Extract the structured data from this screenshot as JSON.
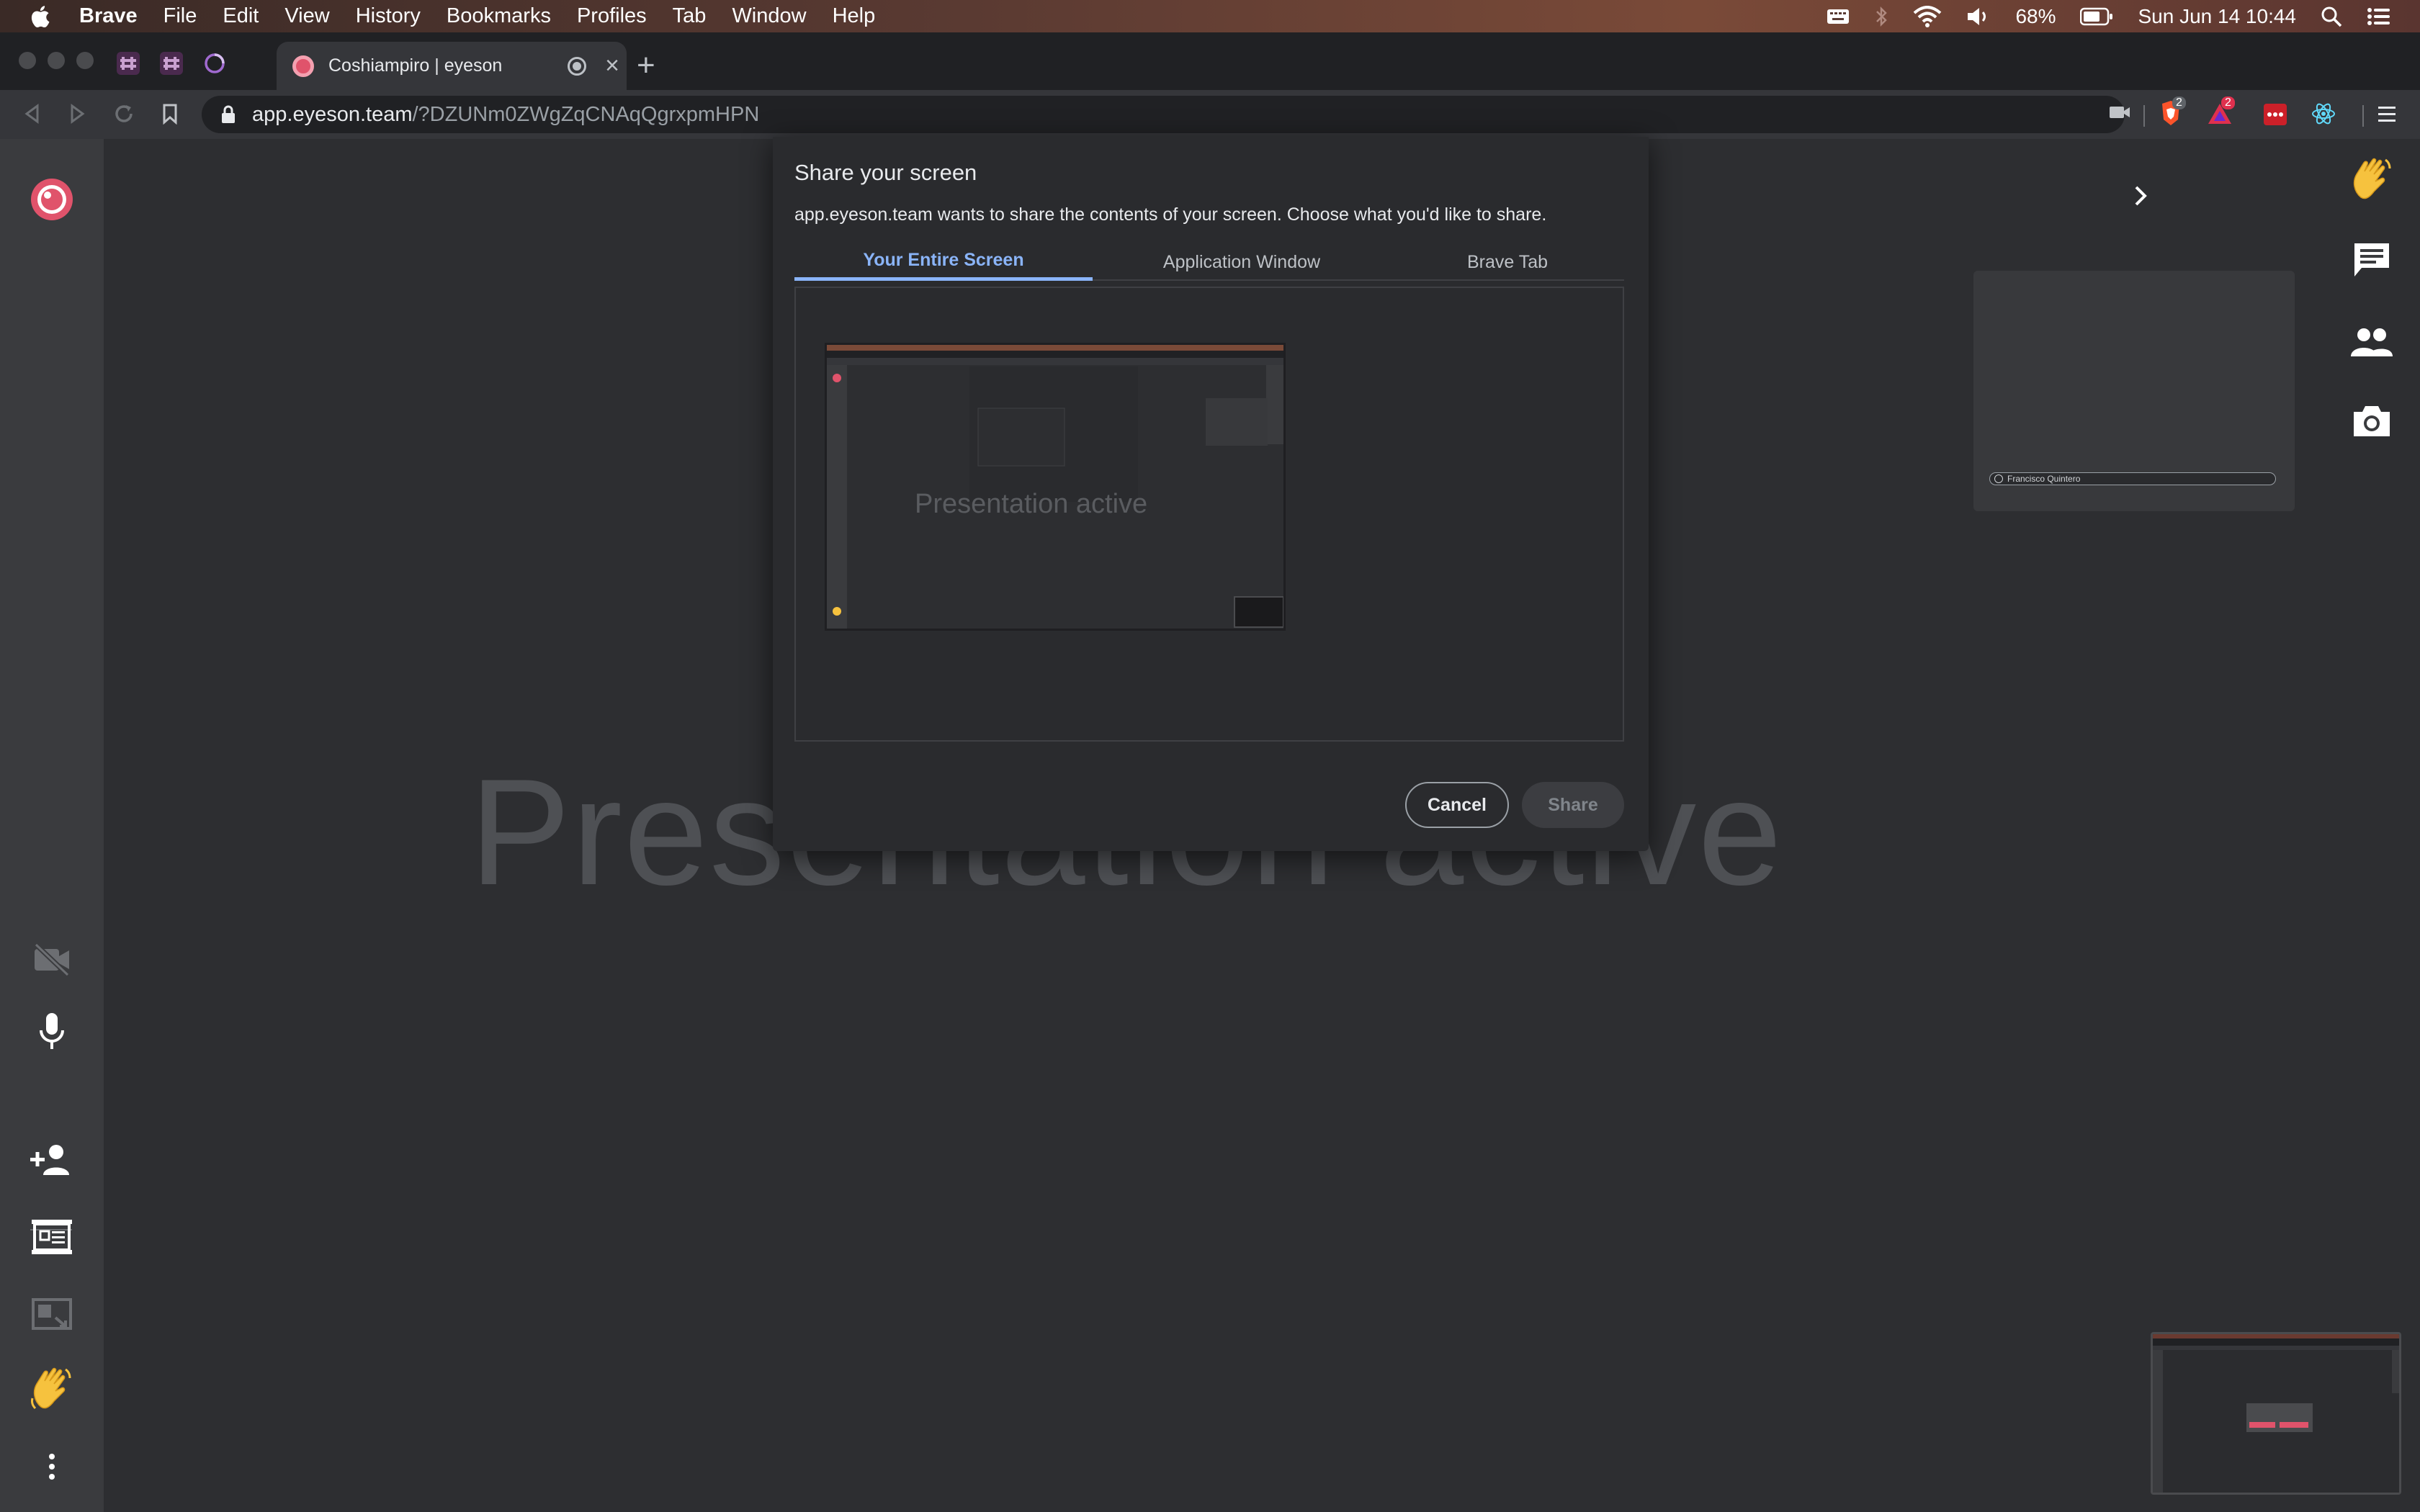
{
  "menubar": {
    "app_name": "Brave",
    "items": [
      "File",
      "Edit",
      "View",
      "History",
      "Bookmarks",
      "Profiles",
      "Tab",
      "Window",
      "Help"
    ],
    "battery": "68%",
    "datetime": "Sun Jun 14  10:44"
  },
  "browser": {
    "tab_title": "Coshiampiro | eyeson",
    "url_host": "app.eyeson.team",
    "url_path": "/?DZUNm0ZWgZqCNAqQgrxpmHPN",
    "brave_badge": "2",
    "rewards_badge": "2"
  },
  "stage": {
    "presentation_text": "Presentation active",
    "participant_name": "Francisco Quintero"
  },
  "dialog": {
    "title": "Share your screen",
    "subtitle": "app.eyeson.team wants to share the contents of your screen. Choose what you'd like to share.",
    "tabs": [
      "Your Entire Screen",
      "Application Window",
      "Brave Tab"
    ],
    "active_tab": "Your Entire Screen",
    "thumb_text": "Presentation active",
    "cancel_label": "Cancel",
    "share_label": "Share"
  },
  "colors": {
    "accent": "#8ab4f8",
    "brand": "#e0536b",
    "background": "#2d2e31"
  },
  "icons": {
    "left_sidebar": [
      "eyeson-logo-icon",
      "camera-off-icon",
      "microphone-icon",
      "add-person-icon",
      "presentation-icon",
      "screen-share-icon",
      "wave-hand-icon",
      "more-vert-icon"
    ],
    "right_sidebar": [
      "wave-hand-icon",
      "chat-icon",
      "people-icon",
      "camera-icon"
    ]
  }
}
